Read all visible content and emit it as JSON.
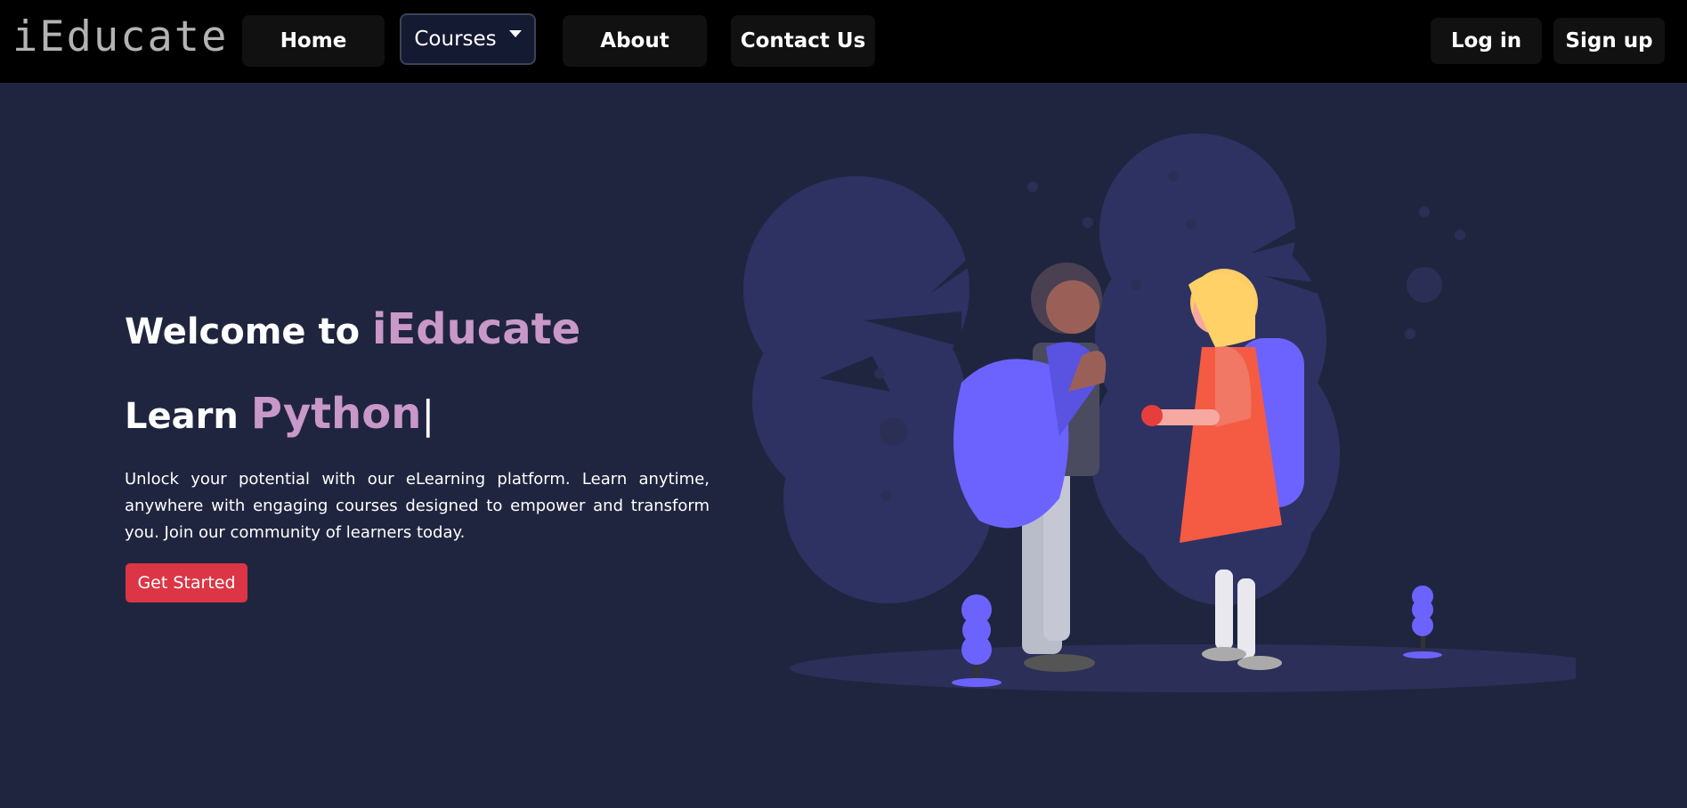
{
  "navbar": {
    "brand": "iEducate",
    "links": {
      "home": "Home",
      "courses": "Courses",
      "about": "About",
      "contact": "Contact Us"
    },
    "auth": {
      "login": "Log in",
      "signup": "Sign up"
    }
  },
  "hero": {
    "welcome_prefix": "Welcome to",
    "welcome_brand": "iEducate",
    "learn_prefix": "Learn",
    "learn_subject": "Python",
    "cursor": "|",
    "description": "Unlock your potential with our eLearning platform. Learn anytime, anywhere with engaging courses designed to empower and transform you. Join our community of learners today.",
    "cta_label": "Get Started"
  },
  "colors": {
    "page_bg": "#20253f",
    "navbar_bg": "#000000",
    "accent_text": "#c898c8",
    "cta_bg": "#dc3545",
    "illustration_purple": "#6c63ff"
  }
}
